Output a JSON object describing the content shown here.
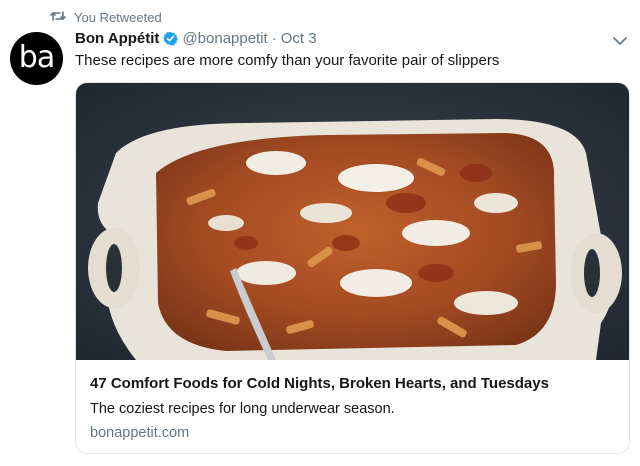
{
  "retweet": {
    "icon": "retweet-icon",
    "label": "You Retweeted"
  },
  "tweet": {
    "avatar": {
      "text": "ba",
      "bg": "#000000"
    },
    "author_name": "Bon Appétit",
    "verified_icon": "verified-badge-icon",
    "handle": "@bonappetit",
    "separator": "·",
    "date": "Oct 3",
    "menu_icon": "chevron-down-icon",
    "text": "These recipes are more comfy than your favorite pair of slippers"
  },
  "card": {
    "image_subject": "baked ziti casserole in ceramic dish",
    "title": "47 Comfort Foods for Cold Nights, Broken Hearts, and Tuesdays",
    "description": "The coziest recipes for long underwear season.",
    "domain": "bonappetit.com"
  },
  "colors": {
    "text_primary": "#14171a",
    "text_secondary": "#657786",
    "verified_blue": "#1da1f2",
    "card_border": "#e1e8ed"
  }
}
